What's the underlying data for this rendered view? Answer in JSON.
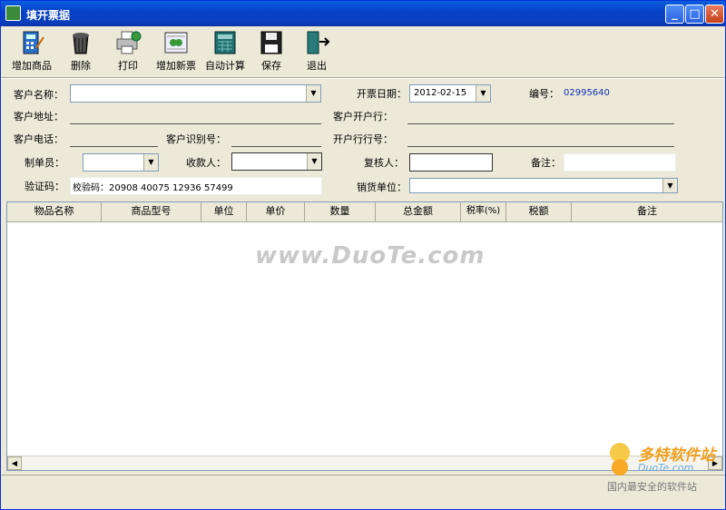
{
  "window": {
    "title": "填开票据"
  },
  "toolbar": [
    {
      "label": "增加商品",
      "icon": "calculator-icon"
    },
    {
      "label": "删除",
      "icon": "trash-icon"
    },
    {
      "label": "打印",
      "icon": "printer-icon"
    },
    {
      "label": "增加新票",
      "icon": "new-ticket-icon"
    },
    {
      "label": "自动计算",
      "icon": "calculator2-icon"
    },
    {
      "label": "保存",
      "icon": "floppy-icon"
    },
    {
      "label": "退出",
      "icon": "exit-door-icon"
    }
  ],
  "form": {
    "customer_name_label": "客户名称：",
    "customer_addr_label": "客户地址：",
    "customer_phone_label": "客户电话：",
    "customer_id_label": "客户识别号：",
    "maker_label": "制单员：",
    "payee_label": "收款人：",
    "verify_label": "验证码：",
    "verify_value": "校验码：20908 40075 12936 57499",
    "date_label": "开票日期：",
    "date_value": "2012-02-15",
    "bank_label": "客户开户行：",
    "bank_no_label": "开户行行号：",
    "reviewer_label": "复核人：",
    "seller_label": "销货单位：",
    "number_label": "编号：",
    "number_value": "02995640",
    "remark_label": "备注："
  },
  "table": {
    "columns": [
      "物品名称",
      "商品型号",
      "单位",
      "单价",
      "数量",
      "总金额",
      "税率(%)",
      "税额",
      "备注"
    ]
  },
  "watermark": "www.DuoTe.com",
  "logo": {
    "brand": "多特软件站",
    "site": "DuoTe.com",
    "slogan": "国内最安全的软件站"
  }
}
